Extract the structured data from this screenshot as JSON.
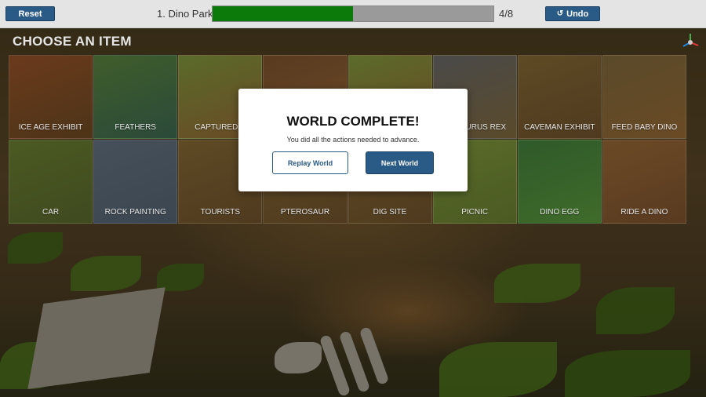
{
  "topbar": {
    "reset_label": "Reset",
    "world_label": "1. Dino Park",
    "progress": {
      "completed": 4,
      "total": 8,
      "text": "4/8",
      "fill_fraction": 0.5,
      "fill_color": "#0b7a0b"
    },
    "undo_label": "Undo",
    "undo_icon": "undo-arrow-icon"
  },
  "section_title": "CHOOSE AN ITEM",
  "items": [
    {
      "label": "ICE AGE EXHIBIT"
    },
    {
      "label": "FEATHERS"
    },
    {
      "label": "CAPTURED D"
    },
    {
      "label": ""
    },
    {
      "label": ""
    },
    {
      "label": "NOSAURUS REX"
    },
    {
      "label": "CAVEMAN EXHIBIT"
    },
    {
      "label": "FEED BABY DINO"
    },
    {
      "label": "CAR"
    },
    {
      "label": "ROCK PAINTING"
    },
    {
      "label": "TOURISTS"
    },
    {
      "label": "PTEROSAUR"
    },
    {
      "label": "DIG SITE"
    },
    {
      "label": "PICNIC"
    },
    {
      "label": "DINO EGG"
    },
    {
      "label": "RIDE A DINO"
    }
  ],
  "modal": {
    "title": "WORLD COMPLETE!",
    "message": "You did all the actions needed to advance.",
    "replay_label": "Replay World",
    "next_label": "Next World"
  },
  "colors": {
    "accent": "#2a5a86",
    "progress_fill": "#0b7a0b",
    "progress_track": "#9a9a9a"
  }
}
